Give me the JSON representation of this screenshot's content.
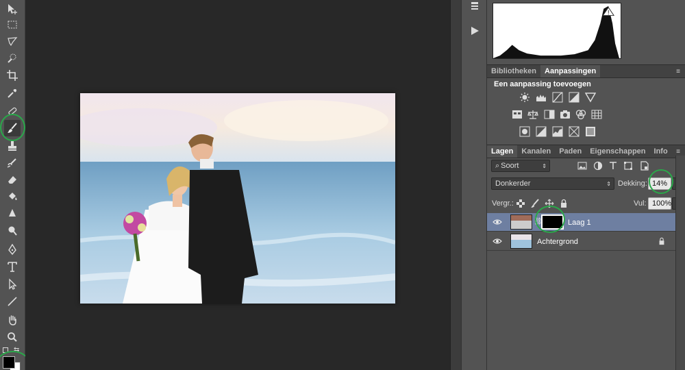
{
  "panels": {
    "adjust_tabs": [
      {
        "label": "Bibliotheken"
      },
      {
        "label": "Aanpassingen"
      }
    ],
    "adjust_title": "Een aanpassing toevoegen",
    "layer_tabs": [
      {
        "label": "Lagen"
      },
      {
        "label": "Kanalen"
      },
      {
        "label": "Paden"
      },
      {
        "label": "Eigenschappen"
      },
      {
        "label": "Info"
      }
    ],
    "filter_value": "Soort",
    "blend_mode": "Donkerder",
    "opacity_label": "Dekking:",
    "opacity_value": "14%",
    "lock_label": "Vergr.:",
    "fill_label": "Vul:",
    "fill_value": "100%",
    "layers": [
      {
        "name": "Laag 1",
        "selected": true
      },
      {
        "name": "Achtergrond",
        "locked": true
      }
    ]
  },
  "colors": {
    "ui_dark": "#282828",
    "panel": "#535353",
    "selection": "#6e7fa1",
    "highlight_circle": "#2aa84a"
  },
  "icons": {
    "tools": [
      "move-icon",
      "marquee-icon",
      "lasso-icon",
      "quick-select-icon",
      "crop-icon",
      "eyedropper-icon",
      "healing-brush-icon",
      "brush-icon",
      "clone-stamp-icon",
      "history-brush-icon",
      "eraser-icon",
      "paint-bucket-icon",
      "blur-icon",
      "dodge-icon",
      "pen-icon",
      "type-icon",
      "path-select-icon",
      "line-icon",
      "hand-icon",
      "zoom-icon"
    ]
  }
}
